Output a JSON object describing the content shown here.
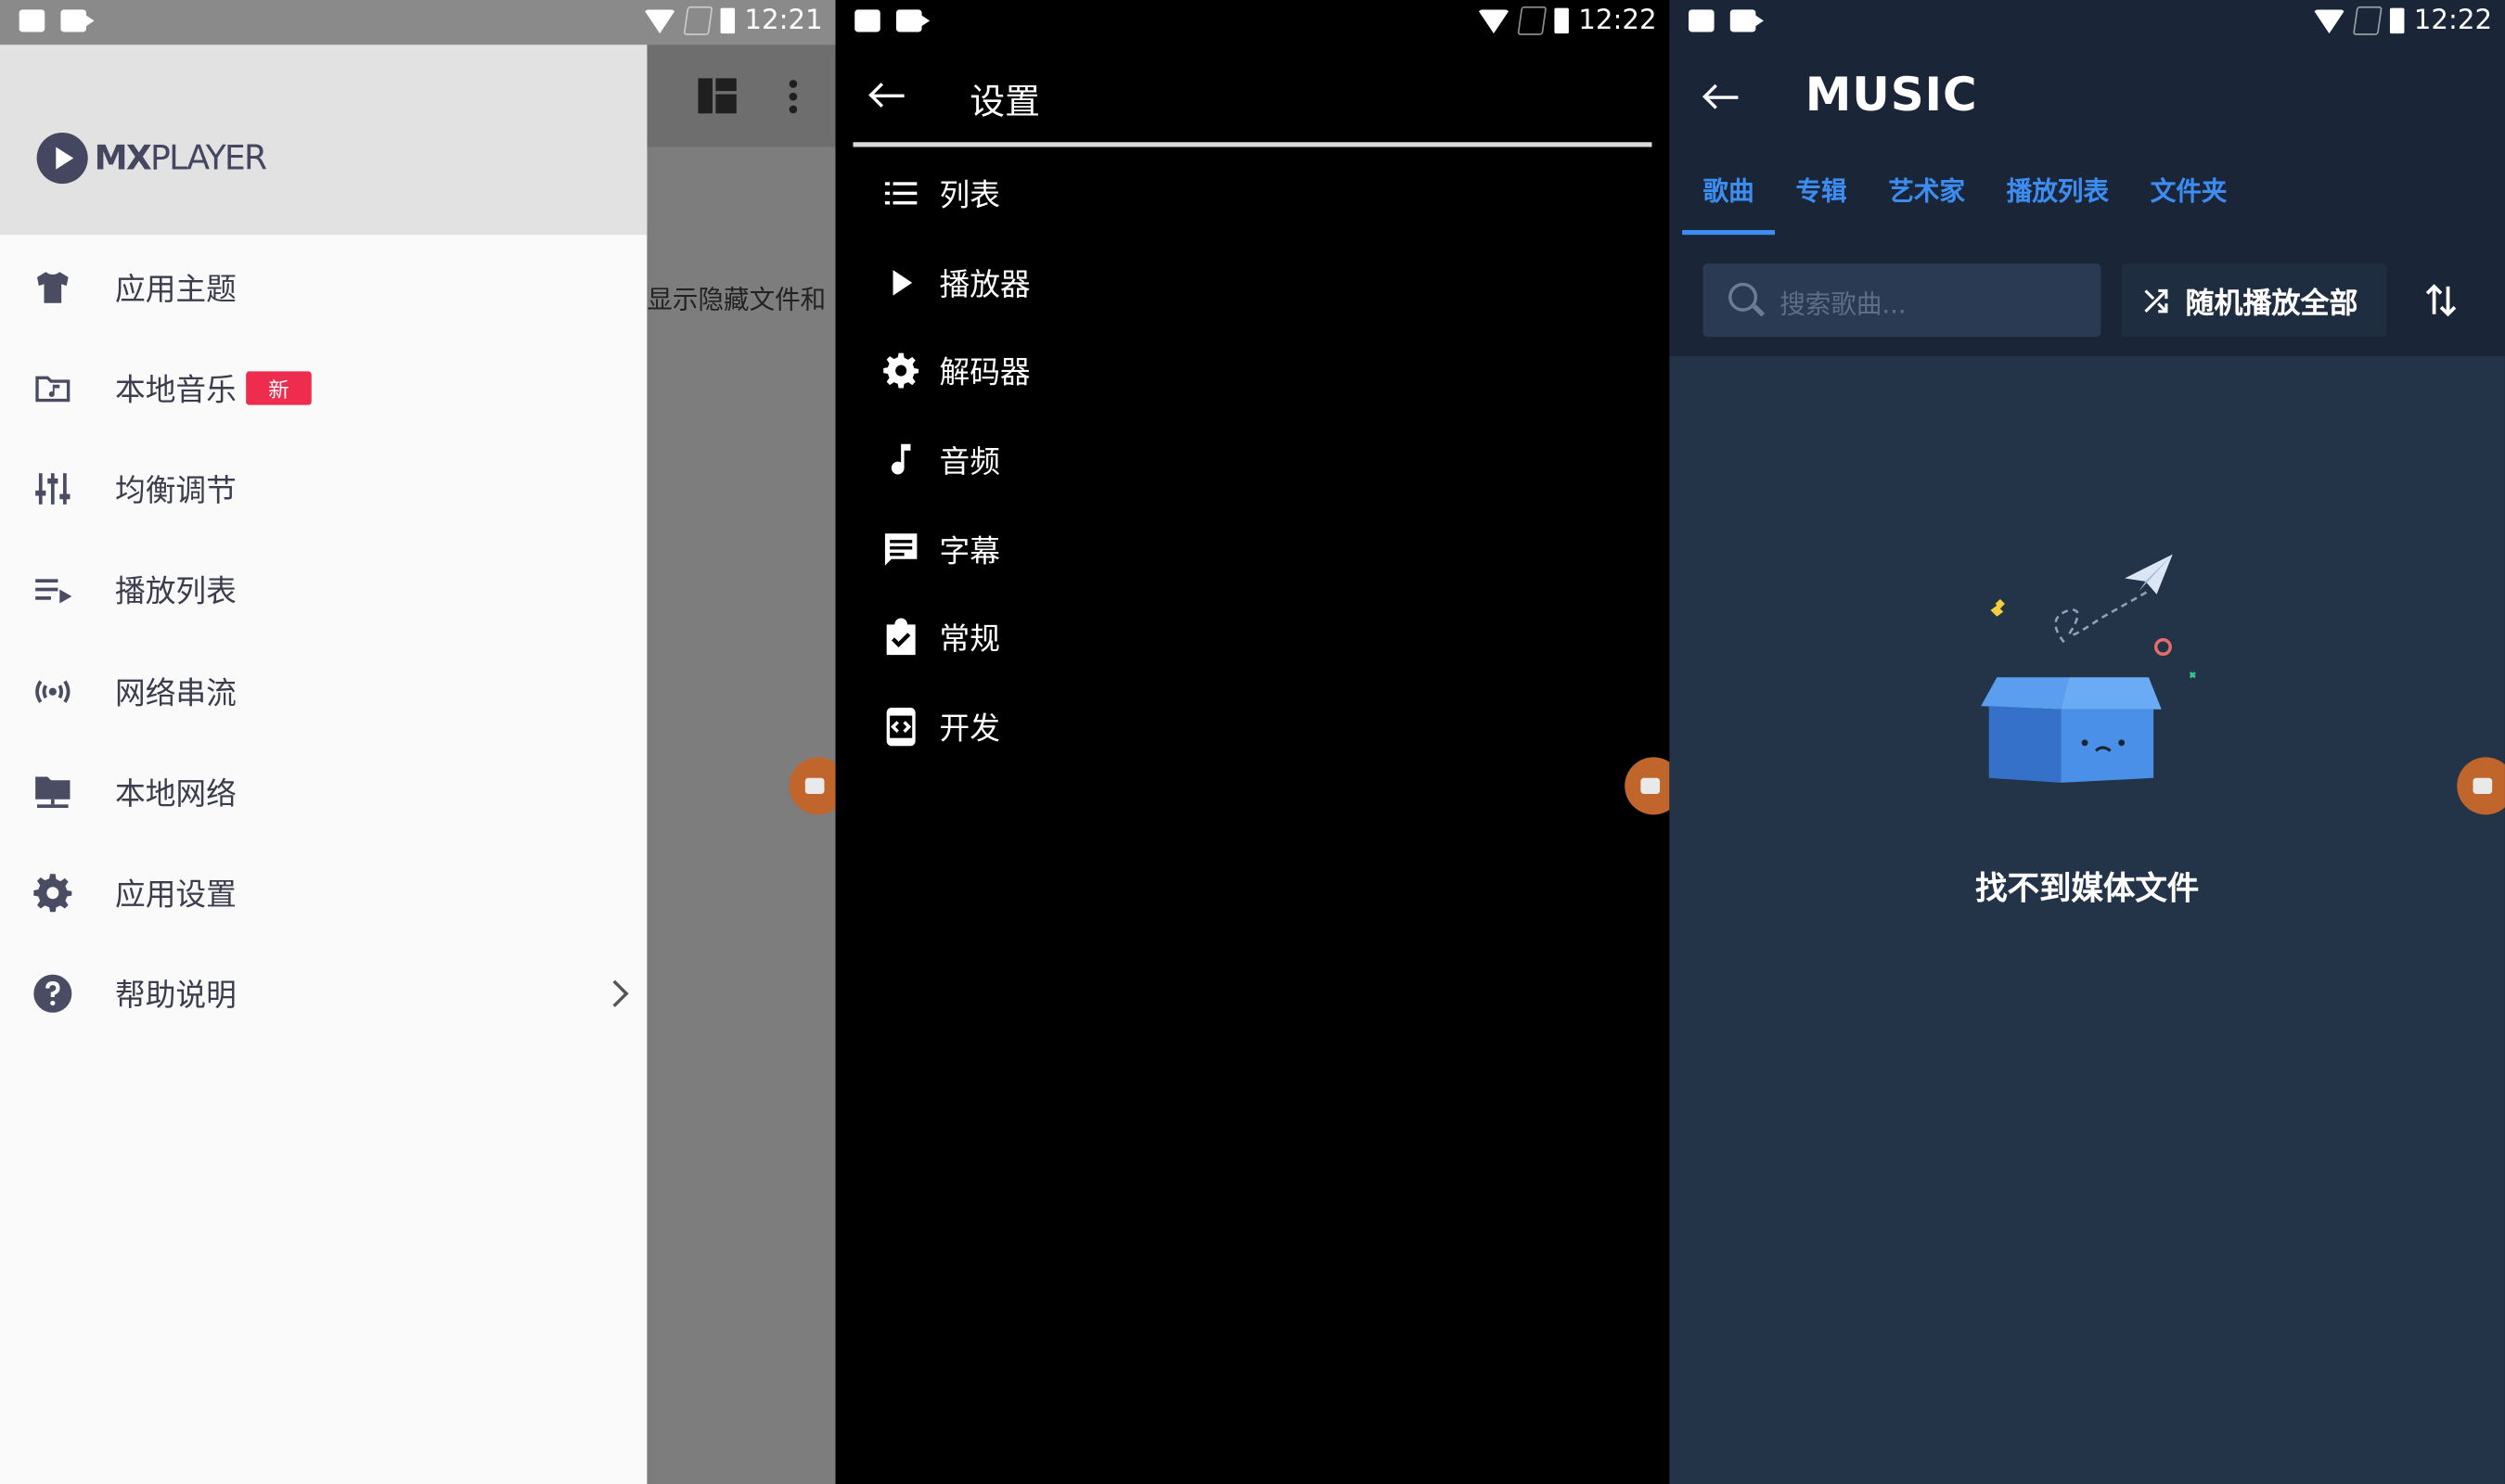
{
  "panel1": {
    "statusbar": {
      "time": "12:21"
    },
    "background": {
      "text": "显示隐藏文件和"
    },
    "drawer": {
      "logo": {
        "mx": "MX",
        "player": "PLAYER"
      },
      "items": [
        {
          "label": "应用主题",
          "icon": "shirt-icon"
        },
        {
          "label": "本地音乐",
          "icon": "music-folder-icon",
          "badge": "新"
        },
        {
          "label": "均衡调节",
          "icon": "equalizer-icon"
        },
        {
          "label": "播放列表",
          "icon": "playlist-icon"
        },
        {
          "label": "网络串流",
          "icon": "stream-icon"
        },
        {
          "label": "本地网络",
          "icon": "network-folder-icon"
        },
        {
          "label": "应用设置",
          "icon": "gear-icon"
        },
        {
          "label": "帮助说明",
          "icon": "help-icon"
        }
      ]
    }
  },
  "panel2": {
    "statusbar": {
      "time": "12:22"
    },
    "title": "设置",
    "items": [
      {
        "label": "列表",
        "icon": "list-icon"
      },
      {
        "label": "播放器",
        "icon": "play-icon"
      },
      {
        "label": "解码器",
        "icon": "gear-icon"
      },
      {
        "label": "音频",
        "icon": "music-note-icon"
      },
      {
        "label": "字幕",
        "icon": "subtitle-icon"
      },
      {
        "label": "常规",
        "icon": "clipboard-check-icon"
      },
      {
        "label": "开发",
        "icon": "developer-icon"
      }
    ]
  },
  "panel3": {
    "statusbar": {
      "time": "12:22"
    },
    "title": "MUSIC",
    "tabs": [
      "歌曲",
      "专辑",
      "艺术家",
      "播放列表",
      "文件夹"
    ],
    "search_placeholder": "搜索歌曲...",
    "shuffle_label": "随机播放全部",
    "empty_text": "找不到媒体文件"
  },
  "colors": {
    "drawer_bg": "#fafafa",
    "drawer_head": "#e2e2e2",
    "badge": "#ee2c4e",
    "music_bg": "#233449",
    "music_top": "#1a2637",
    "accent_blue": "#3d8cf0",
    "fab": "#c0652c"
  }
}
